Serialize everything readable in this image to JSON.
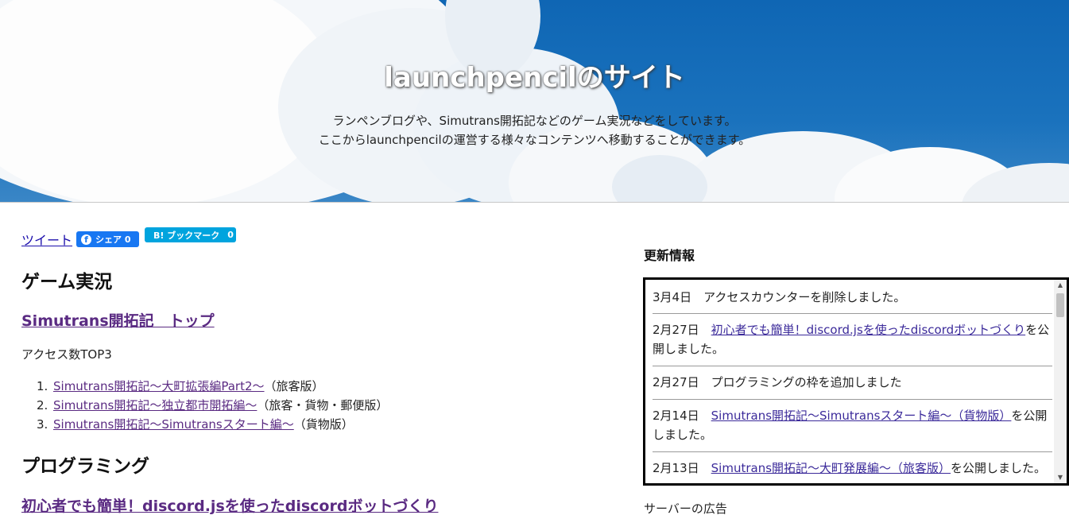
{
  "header": {
    "title": "launchpencilのサイト",
    "subtitle_line1": "ランペンブログや、Simutrans開拓記などのゲーム実況などをしています。",
    "subtitle_line2": "ここからlaunchpencilの運営する様々なコンテンツへ移動することができます。"
  },
  "share": {
    "tweet_label": "ツイート",
    "facebook_label": "シェア 0",
    "hatena_label": "B! ブックマーク",
    "hatena_count": "0"
  },
  "main": {
    "game_heading": "ゲーム実況",
    "simutrans_link": "Simutrans開拓記　トップ",
    "access_label": "アクセス数TOP3",
    "ranking": [
      {
        "num": "1.",
        "link": "Simutrans開拓記～大町拡張編Part2～",
        "note": "（旅客版）"
      },
      {
        "num": "2.",
        "link": "Simutrans開拓記～独立都市開拓編～",
        "note": "（旅客・貨物・郵便版）"
      },
      {
        "num": "3.",
        "link": "Simutrans開拓記～Simutransスタート編～",
        "note": "（貨物版）"
      }
    ],
    "programming_heading": "プログラミング",
    "discord_link": "初心者でも簡単！discord.jsを使ったdiscordボットづくり"
  },
  "news": {
    "heading": "更新情報",
    "items": [
      {
        "date": "3月4日",
        "link": "",
        "text": "アクセスカウンターを削除しました。"
      },
      {
        "date": "2月27日",
        "link": "初心者でも簡単！discord.jsを使ったdiscordボットづくり",
        "text": "を公開しました。"
      },
      {
        "date": "2月27日",
        "link": "",
        "text": "プログラミングの枠を追加しました"
      },
      {
        "date": "2月14日",
        "link": "Simutrans開拓記～Simutransスタート編～（貨物版）",
        "text": "を公開しました。"
      },
      {
        "date": "2月13日",
        "link": "Simutrans開拓記～大町発展編～（旅客版）",
        "text": "を公開しました。"
      }
    ]
  },
  "sidebar": {
    "ad_label": "サーバーの広告"
  },
  "colors": {
    "sky": "#1a72bd",
    "link_visited": "#5a2a82",
    "facebook": "#1877f2",
    "hatena": "#00a4de"
  }
}
